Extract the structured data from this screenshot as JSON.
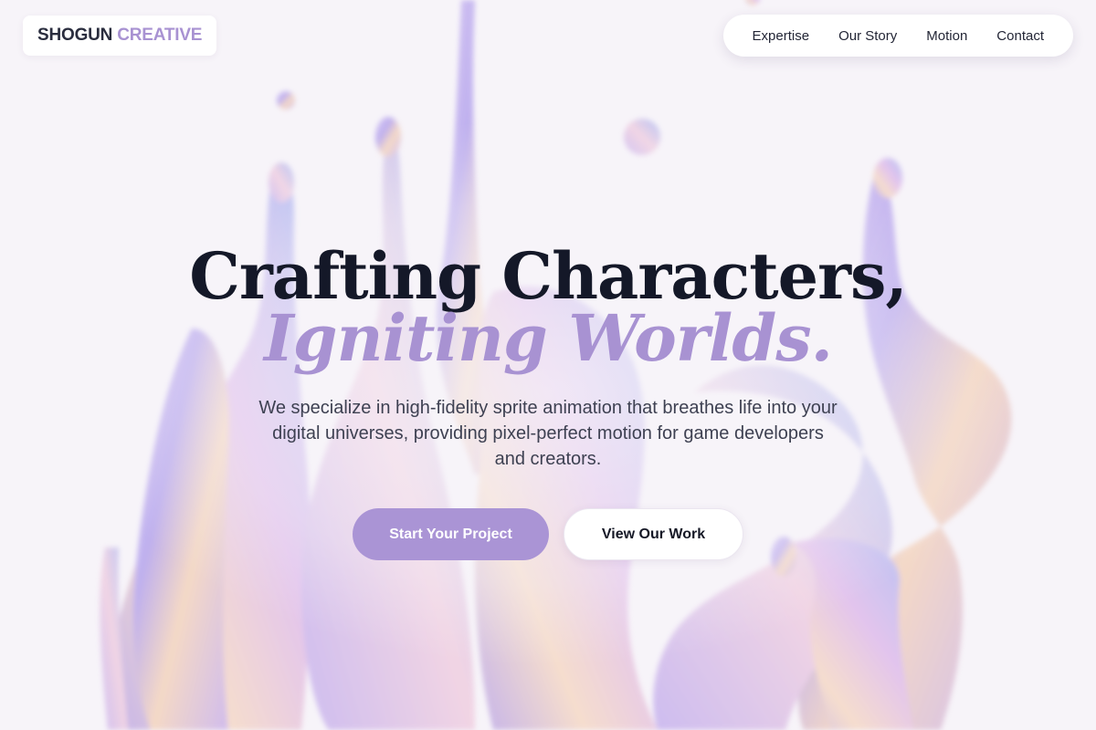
{
  "brand": {
    "name_primary": "SHOGUN",
    "name_accent": "CREATIVE"
  },
  "nav": {
    "items": [
      {
        "label": "Expertise"
      },
      {
        "label": "Our Story"
      },
      {
        "label": "Motion"
      },
      {
        "label": "Contact"
      }
    ]
  },
  "hero": {
    "headline_line1": "Crafting Characters,",
    "headline_line2": "Igniting Worlds.",
    "subtitle": "We specialize in high-fidelity sprite animation that breathes life into your digital universes, providing pixel-perfect motion for game developers and creators.",
    "primary_cta": "Start Your Project",
    "secondary_cta": "View Our Work",
    "background": "iridescent-liquid-splash"
  },
  "colors": {
    "accent": "#a892d2",
    "text_dark": "#141828",
    "background": "#f7f4f9",
    "button_primary": "#aa94d5"
  }
}
